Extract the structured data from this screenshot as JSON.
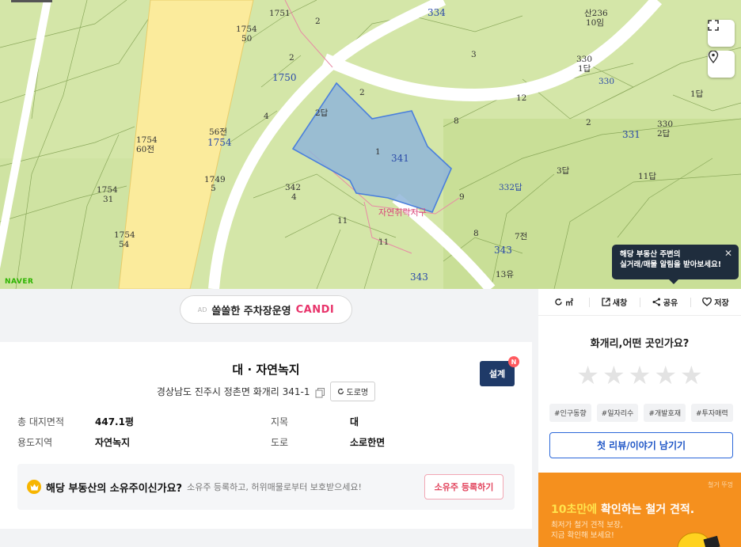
{
  "map": {
    "labels": [
      "1751",
      "2",
      "334",
      "산236",
      "10임",
      "1754",
      "50",
      "2",
      "3",
      "330",
      "1답",
      "1750",
      "330",
      "2",
      "12",
      "1답",
      "2답",
      "4",
      "8",
      "2",
      "330",
      "331",
      "2답",
      "1754",
      "60전",
      "56전",
      "1754",
      "1",
      "341",
      "3답",
      "11답",
      "1749",
      "5",
      "342",
      "4",
      "332답",
      "1754",
      "31",
      "9",
      "11",
      "1754",
      "54",
      "8",
      "7전",
      "11",
      "343",
      "13유",
      "343"
    ],
    "district_label": "자연취락지구",
    "logo": "NAVER",
    "tooltip": {
      "line1": "해당 부동산 주변의",
      "line2": "실거래/매물 알림을 받아보세요!",
      "close": "✕"
    },
    "colors": {
      "land": "#d4e6a8",
      "road": "#ffffff",
      "highlight_road": "#fbeb9c",
      "parcel_fill": "#8fb5d9",
      "parcel_stroke": "#4a7fdc"
    }
  },
  "ad": {
    "tag": "AD",
    "text": "쏠쏠한 주차장운영",
    "brand": "CANDI"
  },
  "property": {
    "title": "대 · 자연녹지",
    "address": "경상남도 진주시 정촌면 화개리 341-1",
    "road_button": "도로명",
    "design_button": "설계",
    "design_badge": "N",
    "fields": [
      {
        "label": "총 대지면적",
        "value": "447.1평"
      },
      {
        "label": "지목",
        "value": "대"
      },
      {
        "label": "용도지역",
        "value": "자연녹지"
      },
      {
        "label": "도로",
        "value": "소로한면"
      }
    ],
    "owner": {
      "question": "해당 부동산의 소유주이신가요?",
      "sub": "소유주 등록하고, 허위매물로부터 보호받으세요!",
      "button": "소유주 등록하기"
    }
  },
  "panel": {
    "tools": [
      {
        "icon": "refresh-icon",
        "label": "㎡"
      },
      {
        "icon": "new-window-icon",
        "label": "새창"
      },
      {
        "icon": "share-icon",
        "label": "공유"
      },
      {
        "icon": "heart-icon",
        "label": "저장"
      }
    ],
    "question": "화개리,어떤 곳인가요?",
    "star_glyph": "★",
    "tags": [
      "#인구동향",
      "#일자리수",
      "#개발호재",
      "#투자매력"
    ],
    "review_button": "첫 리뷰/이야기 남기기"
  },
  "promo": {
    "brand": "철거 뚜껑",
    "title_highlight": "10초만에",
    "title_rest": " 확인하는 철거 견적.",
    "sub1": "최저가 철거 견적 보장,",
    "sub2": "지금 확인해 보세요!"
  }
}
